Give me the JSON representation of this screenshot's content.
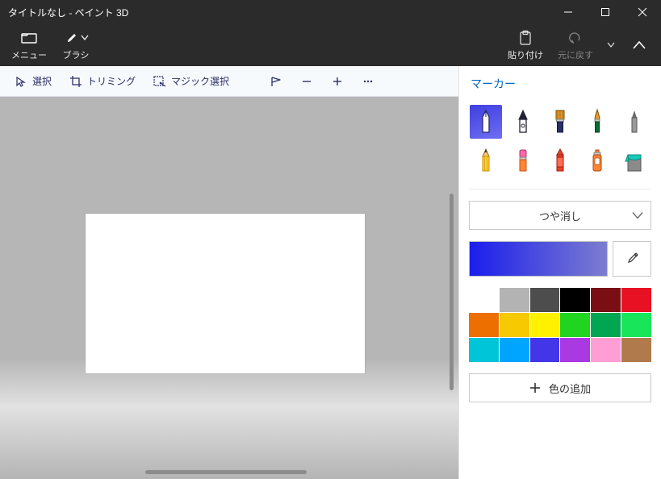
{
  "window": {
    "title": "タイトルなし - ペイント 3D"
  },
  "ribbon": {
    "menu": "メニュー",
    "brushes": "ブラシ",
    "paste": "貼り付け",
    "undo": "元に戻す"
  },
  "toolbar": {
    "select": "選択",
    "crop": "トリミング",
    "magic_select": "マジック選択"
  },
  "panel": {
    "title": "マーカー",
    "finish": "つや消し",
    "add_color": "色の追加"
  },
  "brushes": {
    "tools": [
      {
        "name": "marker",
        "selected": true
      },
      {
        "name": "calligraphy",
        "selected": false
      },
      {
        "name": "flat-brush",
        "selected": false
      },
      {
        "name": "fine-brush",
        "selected": false
      },
      {
        "name": "pen",
        "selected": false
      },
      {
        "name": "pencil",
        "selected": false
      },
      {
        "name": "eraser",
        "selected": false
      },
      {
        "name": "crayon",
        "selected": false
      },
      {
        "name": "spray",
        "selected": false
      },
      {
        "name": "fill",
        "selected": false
      }
    ]
  },
  "swatches": [
    [
      "#ffffff",
      "#b3b3b3",
      "#4d4d4d",
      "#000000",
      "#7a0e14",
      "#e81123"
    ],
    [
      "#ec6f00",
      "#f7c900",
      "#fff100",
      "#20d420",
      "#00a651",
      "#18e55a"
    ],
    [
      "#00c5d9",
      "#00a5ff",
      "#4236e8",
      "#aa39e2",
      "#ff9ed4",
      "#b07a4c"
    ]
  ],
  "colors": {
    "accent_gradient_start": "#1a1eec",
    "accent_gradient_end": "#7d7dcf"
  }
}
